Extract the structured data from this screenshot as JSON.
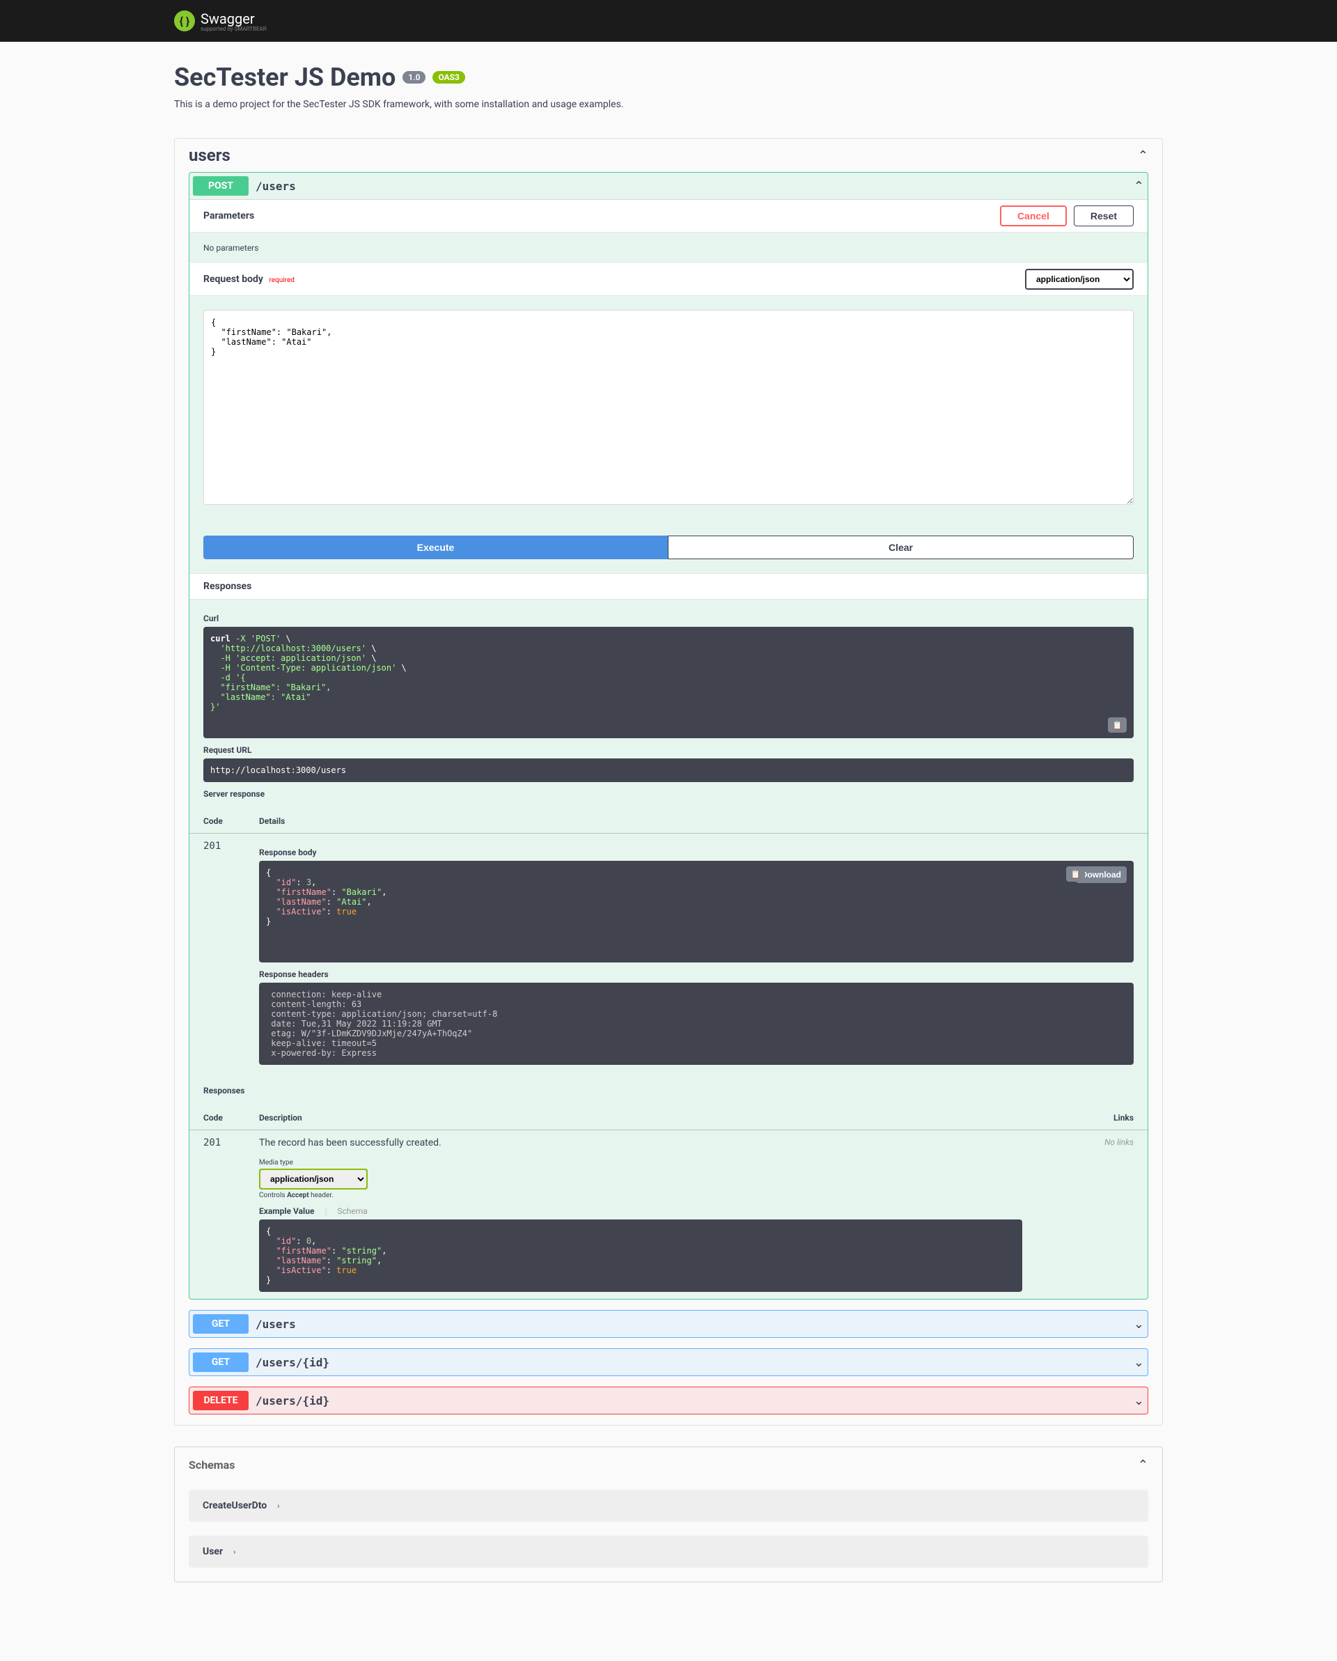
{
  "header": {
    "brand": "Swagger",
    "subbrand": "supported by SMARTBEAR"
  },
  "api": {
    "title": "SecTester JS Demo",
    "version": "1.0",
    "oas": "OAS3",
    "description": "This is a demo project for the SecTester JS SDK framework, with some installation and usage examples."
  },
  "tag": {
    "name": "users"
  },
  "post": {
    "method": "POST",
    "path": "/users",
    "parametersLabel": "Parameters",
    "cancel": "Cancel",
    "reset": "Reset",
    "noParams": "No parameters",
    "reqBodyLabel": "Request body",
    "required": "required",
    "contentType": "application/json",
    "bodyValue": "{\n  \"firstName\": \"Bakari\",\n  \"lastName\": \"Atai\"\n}",
    "execute": "Execute",
    "clear": "Clear",
    "responsesLabel": "Responses",
    "curlLabel": "Curl",
    "curl": "curl -X 'POST' \\\n  'http://localhost:3000/users' \\\n  -H 'accept: application/json' \\\n  -H 'Content-Type: application/json' \\\n  -d '{\n  \"firstName\": \"Bakari\",\n  \"lastName\": \"Atai\"\n}'",
    "requestUrlLabel": "Request URL",
    "requestUrl": "http://localhost:3000/users",
    "serverResponseLabel": "Server response",
    "codeHeader": "Code",
    "detailsHeader": "Details",
    "responseCode": "201",
    "responseBodyLabel": "Response body",
    "responseBody": {
      "id": 3,
      "firstName": "Bakari",
      "lastName": "Atai",
      "isActive": true
    },
    "download": "Download",
    "responseHeadersLabel": "Response headers",
    "responseHeaders": " connection: keep-alive \n content-length: 63 \n content-type: application/json; charset=utf-8 \n date: Tue,31 May 2022 11:19:28 GMT \n etag: W/\"3f-LDmKZDV9DJxMje/247yA+ThOqZ4\" \n keep-alive: timeout=5 \n x-powered-by: Express ",
    "responsesLabel2": "Responses",
    "descriptionHeader": "Description",
    "linksHeader": "Links",
    "docCode": "201",
    "docDescription": "The record has been successfully created.",
    "noLinks": "No links",
    "mediaTypeLabel": "Media type",
    "mediaType": "application/json",
    "acceptNote": "Controls ",
    "acceptWord": "Accept",
    "acceptNote2": " header.",
    "exampleValueTab": "Example Value",
    "schemaTab": "Schema",
    "exampleSchema": {
      "id": 0,
      "firstName": "string",
      "lastName": "string",
      "isActive": true
    }
  },
  "endpoints": [
    {
      "method": "GET",
      "methodClass": "get",
      "path": "/users"
    },
    {
      "method": "GET",
      "methodClass": "get",
      "path": "/users/{id}"
    },
    {
      "method": "DELETE",
      "methodClass": "delete",
      "path": "/users/{id}"
    }
  ],
  "schemas": {
    "title": "Schemas",
    "items": [
      "CreateUserDto",
      "User"
    ]
  }
}
